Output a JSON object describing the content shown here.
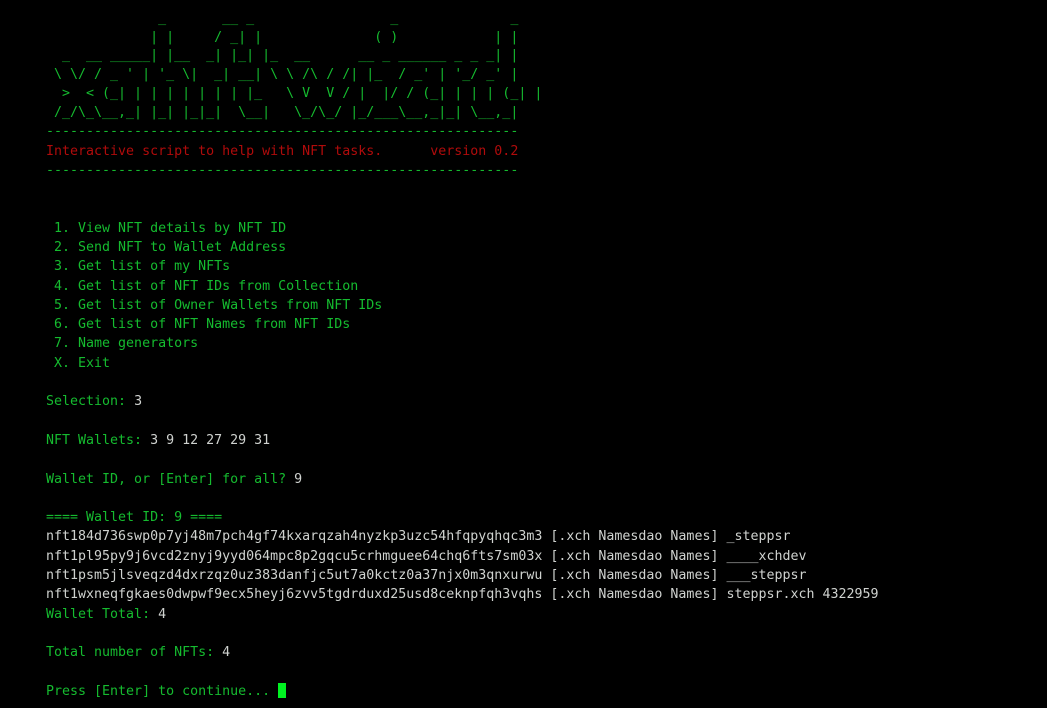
{
  "terminal": {
    "background_color": "#000000",
    "green": "#15bb2f",
    "white": "#cfd2cf",
    "red": "#b00b0b",
    "cursor_color": "#00f221"
  },
  "banner": {
    "name": "xch-nft-wizard-ascii-art",
    "lines": [
      "              _       __ _                 _              _ ",
      "             | |     / _| |              ( )            | |",
      "  _  __ _____| |__  _| |_| |_  __      __ _ ______ _ _ _| |",
      " \\ \\/ / _ ' | '_ \\|  _| __| \\ \\ /\\ / /| |_  / _' | '_/ _' |",
      "  >  < (_| | | | | | | | |_   \\ V  V / |  |/ / (_| | | | (_| |",
      " /_/\\_\\__,_| |_| |_|_|  \\__|   \\_/\\_/ |_/___\\__,_|_| \\__,_|"
    ]
  },
  "separator": {
    "top": "-----------------------------------------------------------",
    "bottom": "-----------------------------------------------------------"
  },
  "tagline": {
    "text": "Interactive script to help with NFT tasks.",
    "version": "version 0.2",
    "full_line": "Interactive script to help with NFT tasks.      version 0.2"
  },
  "menu": {
    "items": [
      {
        "key": "1.",
        "label": "View NFT details by NFT ID",
        "line": " 1. View NFT details by NFT ID"
      },
      {
        "key": "2.",
        "label": "Send NFT to Wallet Address",
        "line": " 2. Send NFT to Wallet Address"
      },
      {
        "key": "3.",
        "label": "Get list of my NFTs",
        "line": " 3. Get list of my NFTs"
      },
      {
        "key": "4.",
        "label": "Get list of NFT IDs from Collection",
        "line": " 4. Get list of NFT IDs from Collection"
      },
      {
        "key": "5.",
        "label": "Get list of Owner Wallets from NFT IDs",
        "line": " 5. Get list of Owner Wallets from NFT IDs"
      },
      {
        "key": "6.",
        "label": "Get list of NFT Names from NFT IDs",
        "line": " 6. Get list of NFT Names from NFT IDs"
      },
      {
        "key": "7.",
        "label": "Name generators",
        "line": " 7. Name generators"
      },
      {
        "key": "X.",
        "label": "Exit",
        "line": " X. Exit"
      }
    ]
  },
  "selection": {
    "prompt": "Selection: ",
    "value": "3"
  },
  "wallets": {
    "prompt": "NFT Wallets: ",
    "value": "3 9 12 27 29 31"
  },
  "wallet_prompt": {
    "prompt": "Wallet ID, or [Enter] for all? ",
    "value": "9"
  },
  "wallet_header": {
    "text": "==== Wallet ID: 9 ===="
  },
  "nft_list": {
    "rows": [
      {
        "id": "nft184d736swp0p7yj48m7pch4gf74kxarqzah4nyzkp3uzc54hfqpyqhqc3m3",
        "collection": "[.xch Namesdao Names]",
        "name": "_steppsr",
        "line": "nft184d736swp0p7yj48m7pch4gf74kxarqzah4nyzkp3uzc54hfqpyqhqc3m3 [.xch Namesdao Names] _steppsr"
      },
      {
        "id": "nft1pl95py9j6vcd2znyj9yyd064mpc8p2gqcu5crhmguee64chq6fts7sm03x",
        "collection": "[.xch Namesdao Names]",
        "name": "____xchdev",
        "line": "nft1pl95py9j6vcd2znyj9yyd064mpc8p2gqcu5crhmguee64chq6fts7sm03x [.xch Namesdao Names] ____xchdev"
      },
      {
        "id": "nft1psm5jlsveqzd4dxrzqz0uz383danfjc5ut7a0kctz0a37njx0m3qnxurwu",
        "collection": "[.xch Namesdao Names]",
        "name": "___steppsr",
        "line": "nft1psm5jlsveqzd4dxrzqz0uz383danfjc5ut7a0kctz0a37njx0m3qnxurwu [.xch Namesdao Names] ___steppsr"
      },
      {
        "id": "nft1wxneqfgkaes0dwpwf9ecx5heyj6zvv5tgdrduxd25usd8ceknpfqh3vqhs",
        "collection": "[.xch Namesdao Names]",
        "name": "steppsr.xch 4322959",
        "line": "nft1wxneqfgkaes0dwpwf9ecx5heyj6zvv5tgdrduxd25usd8ceknpfqh3vqhs [.xch Namesdao Names] steppsr.xch 4322959"
      }
    ]
  },
  "wallet_total": {
    "prompt": "Wallet Total: ",
    "value": "4"
  },
  "total_nfts": {
    "prompt": "Total number of NFTs: ",
    "value": "4"
  },
  "continue_prompt": {
    "text": "Press [Enter] to continue... "
  }
}
